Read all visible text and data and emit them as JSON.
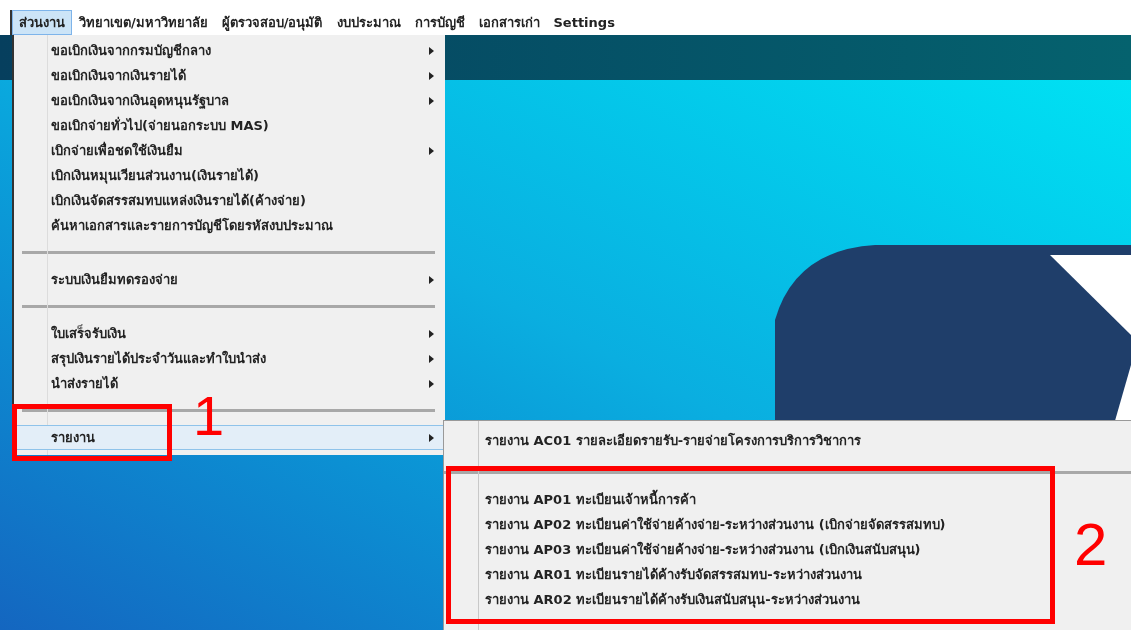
{
  "menubar": [
    {
      "label": "ส่วนงาน",
      "selected": true
    },
    {
      "label": "วิทยาเขต/มหาวิทยาลัย",
      "selected": false
    },
    {
      "label": "ผู้ตรวจสอบ/อนุมัติ",
      "selected": false
    },
    {
      "label": "งบประมาณ",
      "selected": false
    },
    {
      "label": "การบัญชี",
      "selected": false
    },
    {
      "label": "เอกสารเก่า",
      "selected": false
    },
    {
      "label": "Settings",
      "selected": false
    }
  ],
  "menu": {
    "items": [
      {
        "kind": "item",
        "label": "ขอเบิกเงินจากกรมบัญชีกลาง",
        "submenu": true,
        "selected": false
      },
      {
        "kind": "item",
        "label": "ขอเบิกเงินจากเงินรายได้",
        "submenu": true,
        "selected": false
      },
      {
        "kind": "item",
        "label": "ขอเบิกเงินจากเงินอุดหนุนรัฐบาล",
        "submenu": true,
        "selected": false
      },
      {
        "kind": "item",
        "label": "ขอเบิกจ่ายทั่วไป(จ่ายนอกระบบ MAS)",
        "submenu": false,
        "selected": false
      },
      {
        "kind": "item",
        "label": "เบิกจ่ายเพื่อชดใช้เงินยืม",
        "submenu": true,
        "selected": false
      },
      {
        "kind": "item",
        "label": "เบิกเงินหมุนเวียนส่วนงาน(เงินรายได้)",
        "submenu": false,
        "selected": false
      },
      {
        "kind": "item",
        "label": "เบิกเงินจัดสรรสมทบแหล่งเงินรายได้(ค้างจ่าย)",
        "submenu": false,
        "selected": false
      },
      {
        "kind": "item",
        "label": "ค้นหาเอกสารและรายการบัญชีโดยรหัสงบประมาณ",
        "submenu": false,
        "selected": false
      },
      {
        "kind": "separator"
      },
      {
        "kind": "item",
        "label": "ระบบเงินยืมทดรองจ่าย",
        "submenu": true,
        "selected": false
      },
      {
        "kind": "separator"
      },
      {
        "kind": "item",
        "label": "ใบเสร็จรับเงิน",
        "submenu": true,
        "selected": false
      },
      {
        "kind": "item",
        "label": "สรุปเงินรายได้ประจำวันและทำใบนำส่ง",
        "submenu": true,
        "selected": false
      },
      {
        "kind": "item",
        "label": "นำส่งรายได้",
        "submenu": true,
        "selected": false
      },
      {
        "kind": "separator"
      },
      {
        "kind": "item",
        "label": "รายงาน",
        "submenu": true,
        "selected": true
      }
    ]
  },
  "submenu": {
    "items": [
      {
        "kind": "item",
        "label": "รายงาน AC01 รายละเอียดรายรับ-รายจ่ายโครงการบริการวิชาการ"
      },
      {
        "kind": "separator"
      },
      {
        "kind": "item",
        "label": "รายงาน AP01 ทะเบียนเจ้าหนี้การค้า"
      },
      {
        "kind": "item",
        "label": "รายงาน AP02 ทะเบียนค่าใช้จ่ายค้างจ่าย-ระหว่างส่วนงาน (เบิกจ่ายจัดสรรสมทบ)"
      },
      {
        "kind": "item",
        "label": "รายงาน AP03 ทะเบียนค่าใช้จ่ายค้างจ่าย-ระหว่างส่วนงาน (เบิกเงินสนับสนุน)"
      },
      {
        "kind": "item",
        "label": "รายงาน AR01 ทะเบียนรายได้ค้างรับจัดสรรสมทบ-ระหว่างส่วนงาน"
      },
      {
        "kind": "item",
        "label": "รายงาน AR02 ทะเบียนรายได้ค้างรับเงินสนับสนุน-ระหว่างส่วนงาน"
      }
    ]
  },
  "annotations": [
    {
      "label": "1"
    },
    {
      "label": "2"
    }
  ]
}
